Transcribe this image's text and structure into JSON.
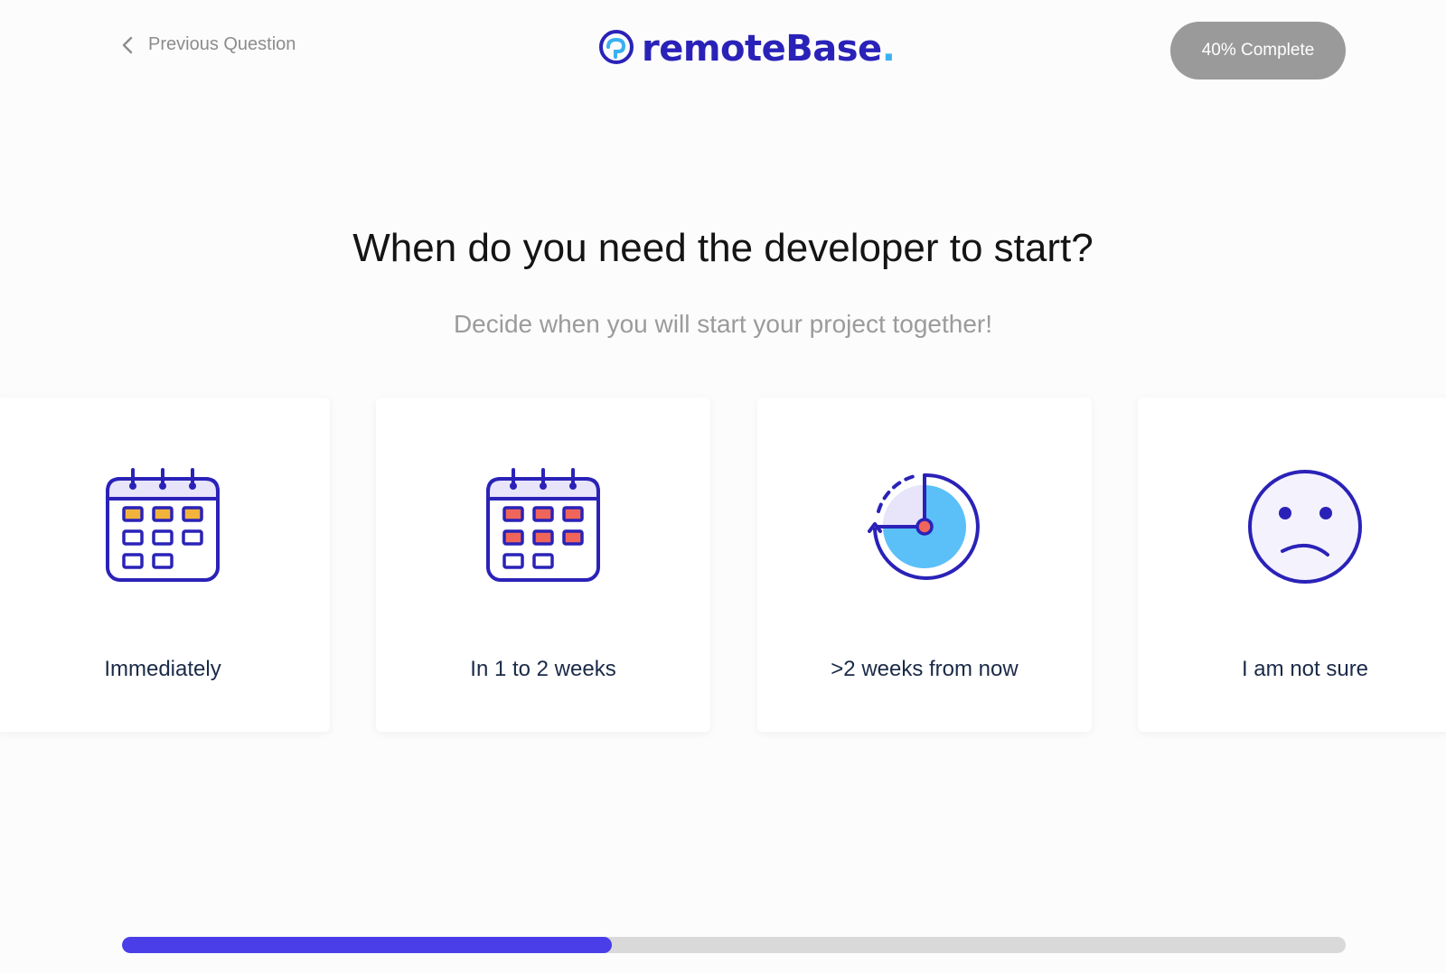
{
  "header": {
    "back_label": "Previous Question",
    "logo_text": "remoteBase",
    "logo_dot": ".",
    "progress_label": "40% Complete"
  },
  "question": {
    "title": "When do you need the developer to start?",
    "subtitle": "Decide when you will start your project together!"
  },
  "options": [
    {
      "label": "Immediately",
      "icon": "calendar-icon"
    },
    {
      "label": "In 1 to 2 weeks",
      "icon": "calendar-icon"
    },
    {
      "label": ">2 weeks from now",
      "icon": "clock-icon"
    },
    {
      "label": "I am not sure",
      "icon": "sad-face-icon"
    }
  ],
  "progress": {
    "fraction": 0.4
  },
  "colors": {
    "brand": "#2a22b8",
    "accent": "#4a3ee8",
    "logo_dot": "#3ab0f0",
    "calendar_cells_1": "#f2b33d",
    "calendar_cells_2": "#f0655a",
    "clock_fill": "#5bc0f8",
    "pill_bg": "#9a9a9a"
  }
}
